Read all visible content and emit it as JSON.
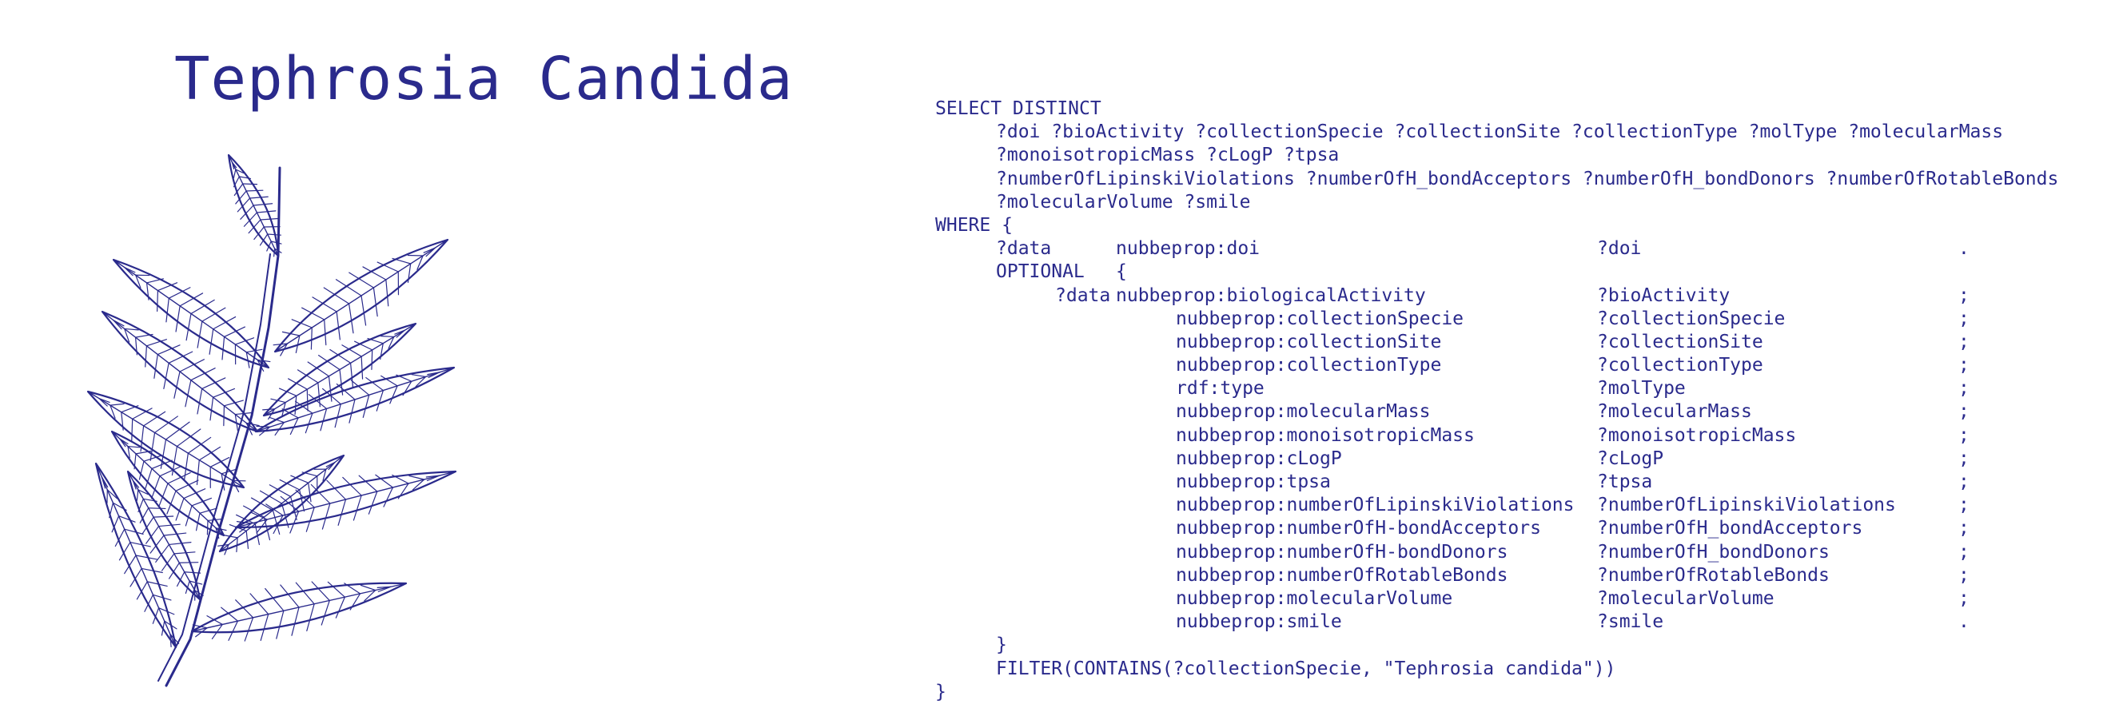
{
  "title": "Tephrosia Candida",
  "illustration": {
    "icon": "fern-leaf-icon",
    "color": "#2a2a8c"
  },
  "query": {
    "select": "SELECT DISTINCT",
    "vars": [
      "?doi ?bioActivity ?collectionSpecie ?collectionSite ?collectionType ?molType ?molecularMass",
      "?monoisotropicMass ?cLogP ?tpsa",
      "?numberOfLipinskiViolations ?numberOfH_bondAcceptors ?numberOfH_bondDonors ?numberOfRotableBonds",
      "?molecularVolume ?smile"
    ],
    "where": "WHERE {",
    "doi_triple": {
      "subject": "?data",
      "predicate": "nubbeprop:doi",
      "object": "?doi",
      "end": "."
    },
    "optional_open": "OPTIONAL",
    "optional_brace": "{",
    "first_triple": {
      "subject": "?data",
      "predicate": "nubbeprop:biologicalActivity",
      "object": "?bioActivity",
      "end": ";"
    },
    "triples": [
      {
        "predicate": "nubbeprop:collectionSpecie",
        "object": "?collectionSpecie",
        "end": ";"
      },
      {
        "predicate": "nubbeprop:collectionSite",
        "object": "?collectionSite",
        "end": ";"
      },
      {
        "predicate": "nubbeprop:collectionType",
        "object": "?collectionType",
        "end": ";"
      },
      {
        "predicate": "rdf:type",
        "object": "?molType",
        "end": ";"
      },
      {
        "predicate": "nubbeprop:molecularMass",
        "object": "?molecularMass",
        "end": ";"
      },
      {
        "predicate": "nubbeprop:monoisotropicMass",
        "object": "?monoisotropicMass",
        "end": ";"
      },
      {
        "predicate": "nubbeprop:cLogP",
        "object": "?cLogP",
        "end": ";"
      },
      {
        "predicate": "nubbeprop:tpsa",
        "object": "?tpsa",
        "end": ";"
      },
      {
        "predicate": "nubbeprop:numberOfLipinskiViolations",
        "object": "?numberOfLipinskiViolations",
        "end": ";"
      },
      {
        "predicate": "nubbeprop:numberOfH-bondAcceptors",
        "object": "?numberOfH_bondAcceptors",
        "end": ";"
      },
      {
        "predicate": "nubbeprop:numberOfH-bondDonors",
        "object": "?numberOfH_bondDonors",
        "end": ";"
      },
      {
        "predicate": "nubbeprop:numberOfRotableBonds",
        "object": "?numberOfRotableBonds",
        "end": ";"
      },
      {
        "predicate": "nubbeprop:molecularVolume",
        "object": "?molecularVolume",
        "end": ";"
      },
      {
        "predicate": "nubbeprop:smile",
        "object": "?smile",
        "end": "."
      }
    ],
    "optional_close": "}",
    "filter": "FILTER(CONTAINS(?collectionSpecie, \"Tephrosia candida\"))",
    "where_close": "}"
  }
}
